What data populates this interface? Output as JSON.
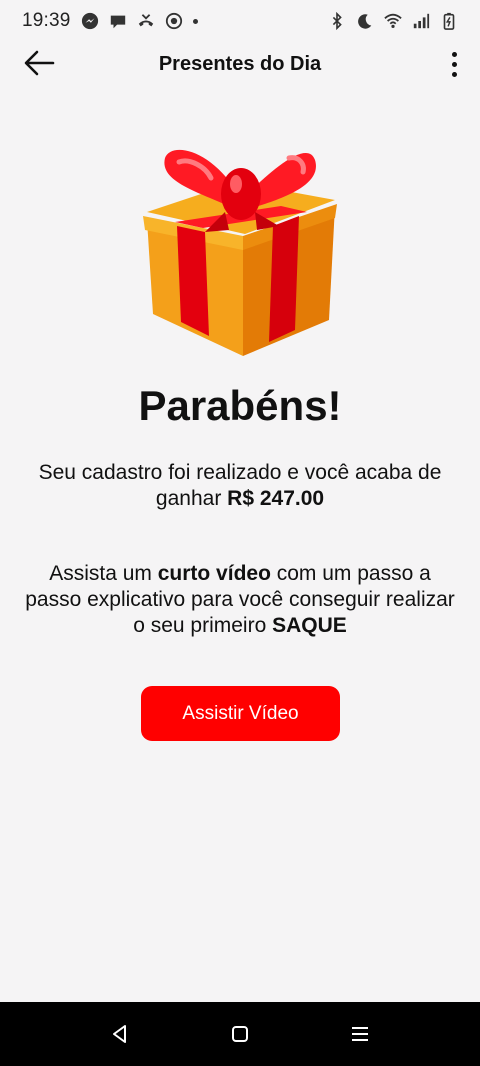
{
  "status_bar": {
    "time": "19:39",
    "left_icons": [
      "messenger-icon",
      "chat-bubble-icon",
      "missed-call-icon",
      "target-icon",
      "notification-dot"
    ],
    "right_icons": [
      "bluetooth-icon",
      "do-not-disturb-moon-icon",
      "wifi-icon",
      "signal-icon",
      "battery-charging-icon"
    ]
  },
  "app_bar": {
    "title": "Presentes do Dia",
    "back_icon": "arrow-left-icon",
    "menu_icon": "more-vertical-icon"
  },
  "content": {
    "gift_icon": "gift-box-icon",
    "headline": "Parabéns!",
    "para1": {
      "text": "Seu cadastro foi realizado e você acaba de ganhar ",
      "amount": "R$ 247.00"
    },
    "para2": {
      "t1": "Assista um ",
      "b1": "curto vídeo",
      "t2": " com um passo a passo explicativo para você conseguir realizar o seu primeiro ",
      "b2": "SAQUE"
    },
    "cta_label": "Assistir Vídeo"
  },
  "colors": {
    "accent": "#ff0000",
    "background": "#f5f4f5",
    "gift_box": "#f39a14",
    "gift_ribbon": "#e8000f"
  },
  "nav_bar": {
    "icons": [
      "back-triangle-icon",
      "home-square-icon",
      "recents-lines-icon"
    ]
  }
}
